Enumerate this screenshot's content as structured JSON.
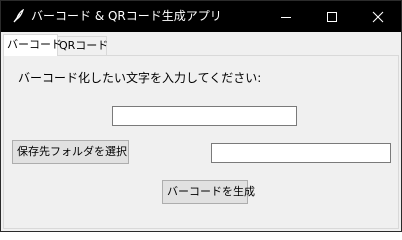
{
  "window": {
    "title": "バーコード & QRコード生成アプリ",
    "icon": "feather-icon",
    "controls": {
      "minimize_icon": "minimize-icon",
      "maximize_icon": "maximize-icon",
      "close_icon": "close-icon"
    }
  },
  "tabs": [
    {
      "label": "バーコード",
      "active": true
    },
    {
      "label": "QRコード",
      "active": false
    }
  ],
  "barcode_tab": {
    "prompt": "バーコード化したい文字を入力してください:",
    "text_input_value": "",
    "folder_button_label": "保存先フォルダを選択",
    "folder_path_value": "",
    "generate_button_label": "バーコードを生成"
  }
}
